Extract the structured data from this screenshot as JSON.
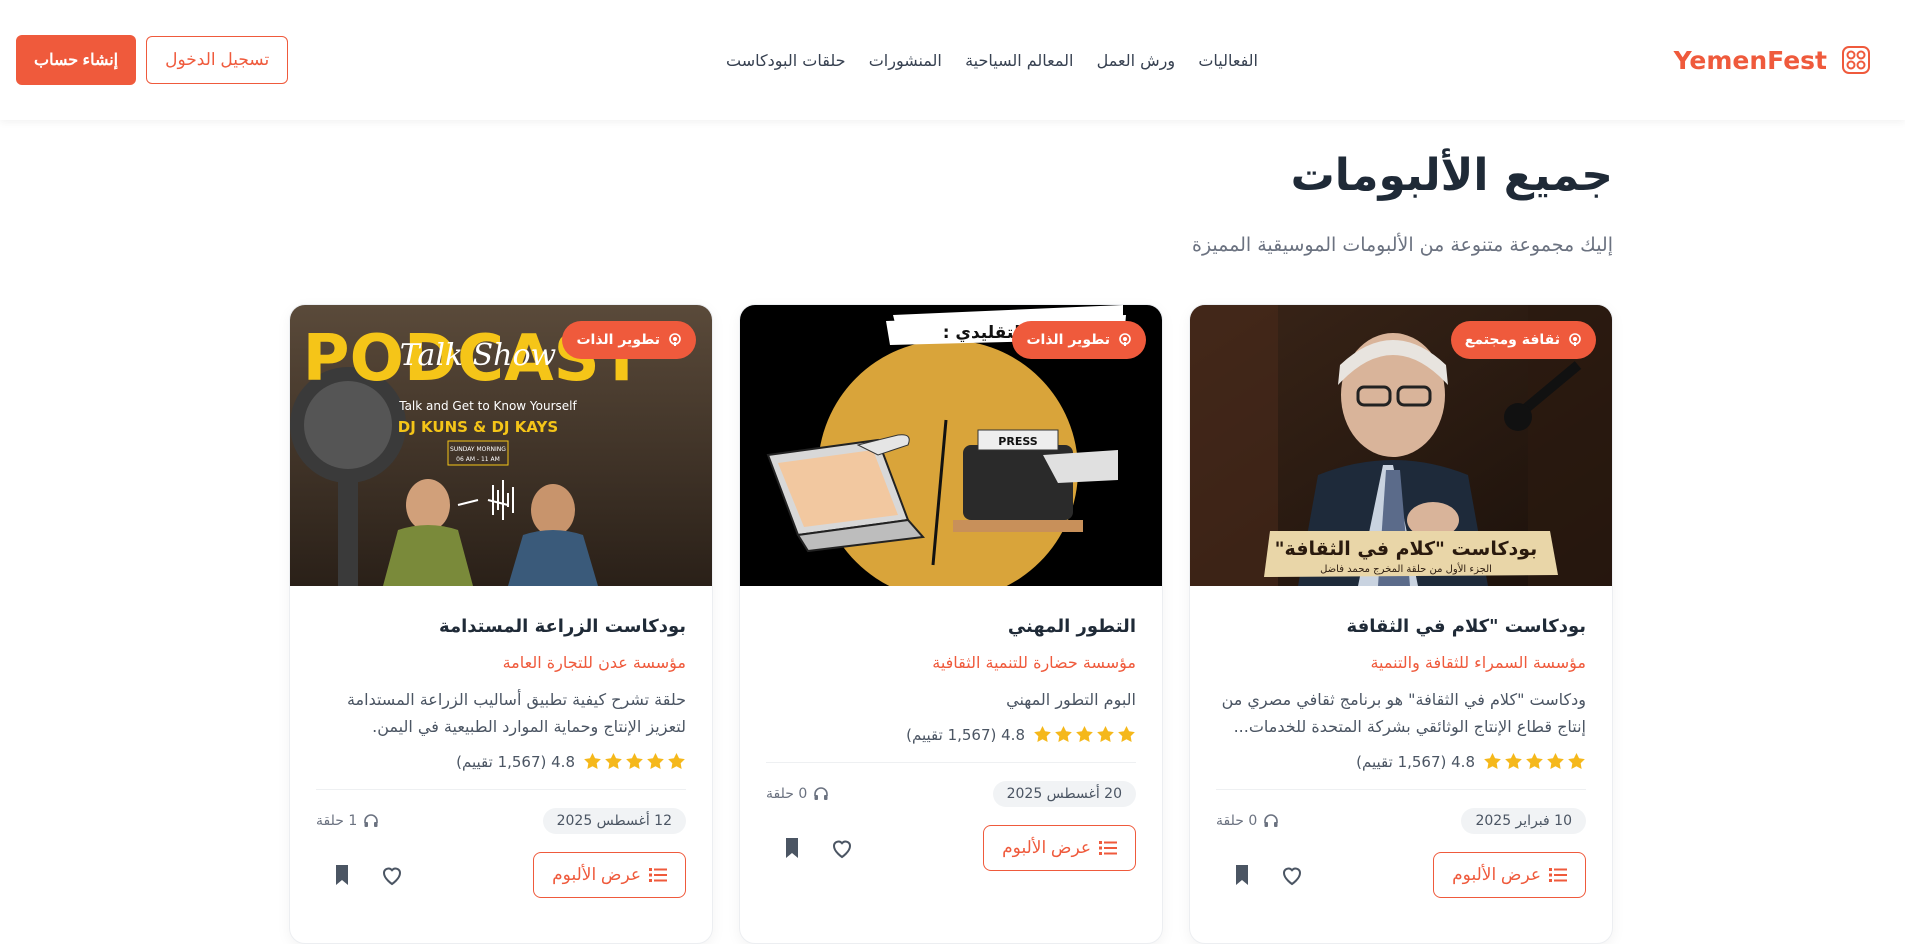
{
  "header": {
    "brand": "YemenFest",
    "nav": [
      "الفعاليات",
      "ورش العمل",
      "المعالم السياحية",
      "المنشورات",
      "حلقات البودكاست"
    ],
    "login_label": "تسجيل الدخول",
    "signup_label": "إنشاء حساب"
  },
  "page": {
    "title": "جميع الألبومات",
    "subtitle": "إليك مجموعة متنوعة من الألبومات الموسيقية المميزة"
  },
  "cards": [
    {
      "badge": "ثقافة ومجتمع",
      "title": "بودكاست \"كلام في الثقافة",
      "org": "مؤسسة السمراء للثقافة والتنمية",
      "desc": "ودكاست \"كلام في الثقافة\" هو برنامج ثقافي مصري من إنتاج قطاع الإنتاج الوثائقي بشركة المتحدة للخدمات...",
      "rating": "4.8 (1,567 تقييم)",
      "stars": 5,
      "date": "10 فبراير 2025",
      "episodes": "0 حلقة",
      "view_label": "عرض الألبوم",
      "image_caption": "بودكاست \"كلام في الثقافة\"",
      "image_sub": "الجزء الأول من حلقة المخرج محمد فاضل"
    },
    {
      "badge": "تطوير الذات",
      "title": "التطور المهني",
      "org": "مؤسسة حضارة للتنمية الثقافية",
      "desc": "البوم التطور المهني",
      "rating": "4.8 (1,567 تقييم)",
      "stars": 5,
      "date": "20 أغسطس 2025",
      "episodes": "0 حلقة",
      "view_label": "عرض الألبوم",
      "image_caption": "والتسويــق التقليدي :",
      "image_sub": "PRESS"
    },
    {
      "badge": "تطوير الذات",
      "title": "بودكاست الزراعة المستدامة",
      "org": "مؤسسة عدن للتجارة العامة",
      "desc": "حلقة تشرح كيفية تطبيق أساليب الزراعة المستدامة لتعزيز الإنتاج وحماية الموارد الطبيعية في اليمن.",
      "rating": "4.8 (1,567 تقييم)",
      "stars": 5,
      "date": "12 أغسطس 2025",
      "episodes": "1 حلقة",
      "view_label": "عرض الألبوم",
      "image_caption": "PODCAST",
      "image_sub": "Talk and Get to Know Yourself",
      "image_names": "DJ KUNS & DJ KAYS",
      "image_time_1": "SUNDAY MORNING",
      "image_time_2": "06 AM - 11 AM",
      "image_script": "Talk Show"
    }
  ],
  "colors": {
    "accent": "#ef5a3c",
    "star": "#f5b81b",
    "title": "#1f2a37"
  }
}
